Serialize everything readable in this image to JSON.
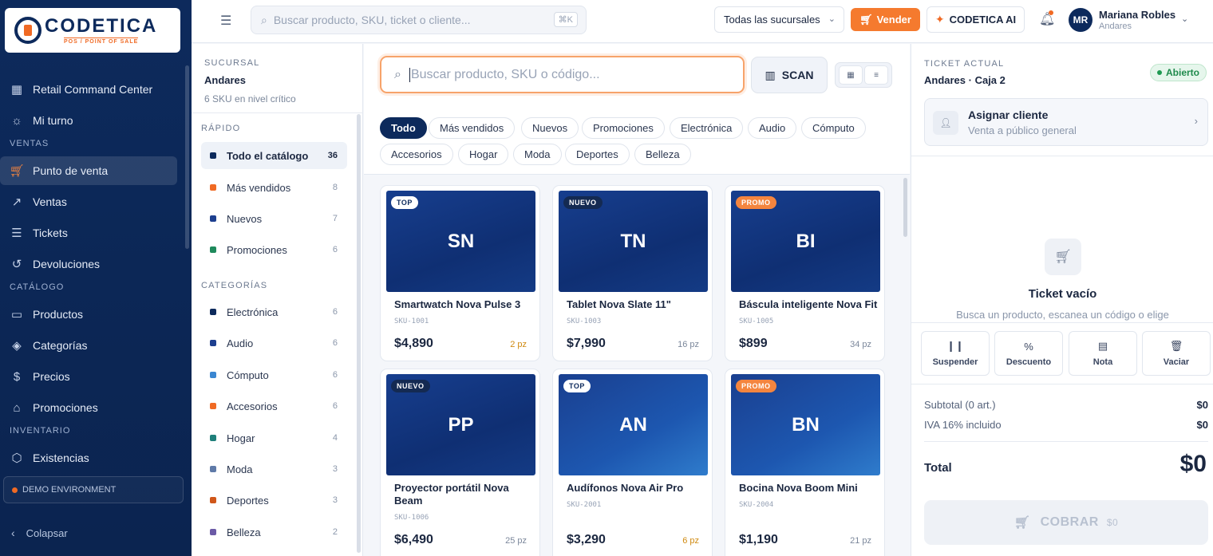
{
  "brand": {
    "name": "CODETICA",
    "tagline": "POS / POINT OF SALE"
  },
  "sidebar": {
    "items": [
      {
        "label": "Retail Command Center",
        "icon": "grid-icon"
      },
      {
        "label": "Mi turno",
        "icon": "sun-icon"
      },
      {
        "label": "Punto de venta",
        "icon": "cart-icon",
        "active": true
      },
      {
        "label": "Ventas",
        "icon": "trend-icon"
      },
      {
        "label": "Tickets",
        "icon": "receipt-icon"
      },
      {
        "label": "Devoluciones",
        "icon": "return-icon"
      },
      {
        "label": "Productos",
        "icon": "box-icon"
      },
      {
        "label": "Categorías",
        "icon": "layers-icon"
      },
      {
        "label": "Precios",
        "icon": "dollar-icon"
      },
      {
        "label": "Promociones",
        "icon": "tag-icon"
      },
      {
        "label": "Existencias",
        "icon": "cube-icon"
      }
    ],
    "sections": {
      "ventas": "VENTAS",
      "catalogo": "CATÁLOGO",
      "inventario": "INVENTARIO"
    },
    "demo": "DEMO ENVIRONMENT",
    "collapse": "Colapsar"
  },
  "topbar": {
    "search_placeholder": "Buscar producto, SKU, ticket o cliente...",
    "shortcut": "⌘K",
    "branch_select": "Todas las sucursales",
    "sell": "Vender",
    "ai": "CODETICA AI",
    "user": {
      "initials": "MR",
      "name": "Mariana Robles",
      "branch": "Andares"
    }
  },
  "filters": {
    "branch_label": "SUCURSAL",
    "branch": "Andares",
    "critical": "6 SKU en nivel crítico",
    "quick_label": "RÁPIDO",
    "quick": [
      {
        "label": "Todo el catálogo",
        "count": "36",
        "color": "#0d2a5c",
        "active": true
      },
      {
        "label": "Más vendidos",
        "count": "8",
        "color": "#f06a24"
      },
      {
        "label": "Nuevos",
        "count": "7",
        "color": "#1d3f8f"
      },
      {
        "label": "Promociones",
        "count": "6",
        "color": "#1f8a5c"
      }
    ],
    "categories_label": "CATEGORÍAS",
    "categories": [
      {
        "label": "Electrónica",
        "count": "6",
        "color": "#0d2a5c"
      },
      {
        "label": "Audio",
        "count": "6",
        "color": "#1d3f8f"
      },
      {
        "label": "Cómputo",
        "count": "6",
        "color": "#3a86d1"
      },
      {
        "label": "Accesorios",
        "count": "6",
        "color": "#f06a24"
      },
      {
        "label": "Hogar",
        "count": "4",
        "color": "#1f7f7a"
      },
      {
        "label": "Moda",
        "count": "3",
        "color": "#5f7aa8"
      },
      {
        "label": "Deportes",
        "count": "3",
        "color": "#d0571a"
      },
      {
        "label": "Belleza",
        "count": "2",
        "color": "#6b5aa6"
      }
    ]
  },
  "catalog": {
    "search_placeholder": "Buscar producto, SKU o código...",
    "scan": "SCAN",
    "chips": [
      "Todo",
      "Más vendidos",
      "Nuevos",
      "Promociones",
      "Electrónica",
      "Audio",
      "Cómputo",
      "Accesorios",
      "Hogar",
      "Moda",
      "Deportes",
      "Belleza"
    ],
    "products": [
      {
        "initials": "SN",
        "badge": "TOP",
        "badge_type": "top",
        "name": "Smartwatch Nova Pulse 3",
        "sku": "SKU-1001",
        "price": "$4,890",
        "stock": "2 pz",
        "low": true
      },
      {
        "initials": "TN",
        "badge": "NUEVO",
        "badge_type": "nuevo",
        "name": "Tablet Nova Slate 11\"",
        "sku": "SKU-1003",
        "price": "$7,990",
        "stock": "16 pz"
      },
      {
        "initials": "BI",
        "badge": "PROMO",
        "badge_type": "promo",
        "name": "Báscula inteligente Nova Fit",
        "sku": "SKU-1005",
        "price": "$899",
        "stock": "34 pz"
      },
      {
        "initials": "PP",
        "badge": "NUEVO",
        "badge_type": "nuevo",
        "name": "Proyector portátil Nova Beam",
        "sku": "SKU-1006",
        "price": "$6,490",
        "stock": "25 pz"
      },
      {
        "initials": "AN",
        "badge": "TOP",
        "badge_type": "top",
        "name": "Audífonos Nova Air Pro",
        "sku": "SKU-2001",
        "price": "$3,290",
        "stock": "6 pz",
        "low": true
      },
      {
        "initials": "BN",
        "badge": "PROMO",
        "badge_type": "promo",
        "name": "Bocina Nova Boom Mini",
        "sku": "SKU-2004",
        "price": "$1,190",
        "stock": "21 pz"
      }
    ]
  },
  "ticket": {
    "label": "TICKET ACTUAL",
    "title": "Andares · Caja 2",
    "status": "Abierto",
    "assign_title": "Asignar cliente",
    "assign_sub": "Venta a público general",
    "empty_title": "Ticket vacío",
    "empty_sub": "Busca un producto, escanea un código o elige",
    "actions": [
      "Suspender",
      "Descuento",
      "Nota",
      "Vaciar"
    ],
    "subtotal_label": "Subtotal (0 art.)",
    "subtotal": "$0",
    "iva_label": "IVA 16% incluido",
    "iva": "$0",
    "total_label": "Total",
    "total": "$0",
    "charge": "COBRAR",
    "charge_amount": "$0"
  }
}
